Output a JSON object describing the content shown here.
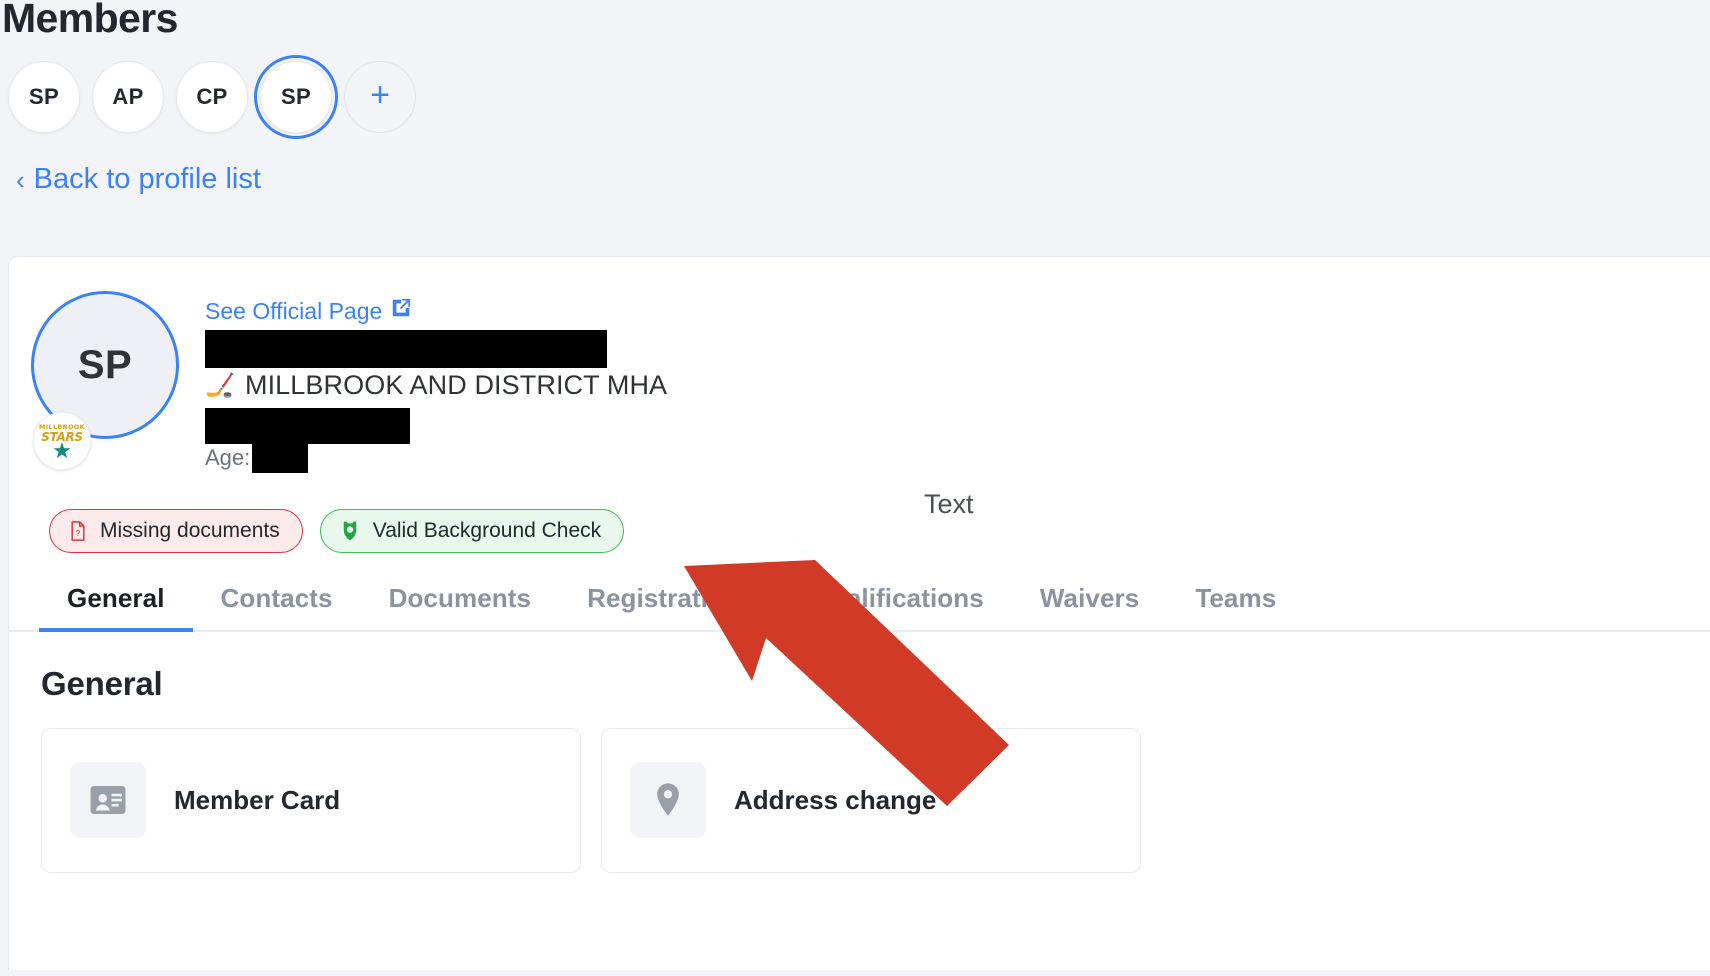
{
  "page": {
    "title": "Members",
    "background_color": "#f3f4f8"
  },
  "member_switcher": {
    "chips": [
      {
        "initials": "SP",
        "selected": false
      },
      {
        "initials": "AP",
        "selected": false
      },
      {
        "initials": "CP",
        "selected": false
      },
      {
        "initials": "SP",
        "selected": true
      }
    ],
    "add_label": "+",
    "accent_color": "#3b82f6"
  },
  "back_link": {
    "chevron": "‹",
    "label": "Back to profile list"
  },
  "profile": {
    "avatar_initials": "SP",
    "club_logo": {
      "top_text": "MILLBROOK",
      "mid_text": "STARS",
      "star": "★"
    },
    "official_page_link": "See Official Page",
    "external_link_icon": "external-link-icon",
    "name_redacted": true,
    "club_emoji": "🏒",
    "club_name": "MILLBROOK AND DISTRICT MHA",
    "extra_redacted": true,
    "age_label": "Age:",
    "age_redacted": true
  },
  "badges": [
    {
      "label": "Missing documents",
      "style": "danger",
      "icon": "file-question-icon",
      "border_color": "#dc3545",
      "background_color": "#fdeaea"
    },
    {
      "label": "Valid Background Check",
      "style": "success",
      "icon": "police-badge-icon",
      "border_color": "#3fbd5b",
      "background_color": "#e9f8ec"
    }
  ],
  "tabs": [
    {
      "label": "General",
      "active": true
    },
    {
      "label": "Contacts",
      "active": false
    },
    {
      "label": "Documents",
      "active": false
    },
    {
      "label": "Registrations",
      "active": false
    },
    {
      "label": "Qualifications",
      "active": false
    },
    {
      "label": "Waivers",
      "active": false
    },
    {
      "label": "Teams",
      "active": false
    }
  ],
  "general_section": {
    "heading": "General",
    "cards": [
      {
        "label": "Member Card",
        "icon": "id-card-icon"
      },
      {
        "label": "Address change",
        "icon": "map-pin-icon"
      }
    ]
  },
  "annotation": {
    "text": "Text",
    "arrow_color": "#d03a27",
    "arrow_points_to": "Valid Background Check"
  }
}
